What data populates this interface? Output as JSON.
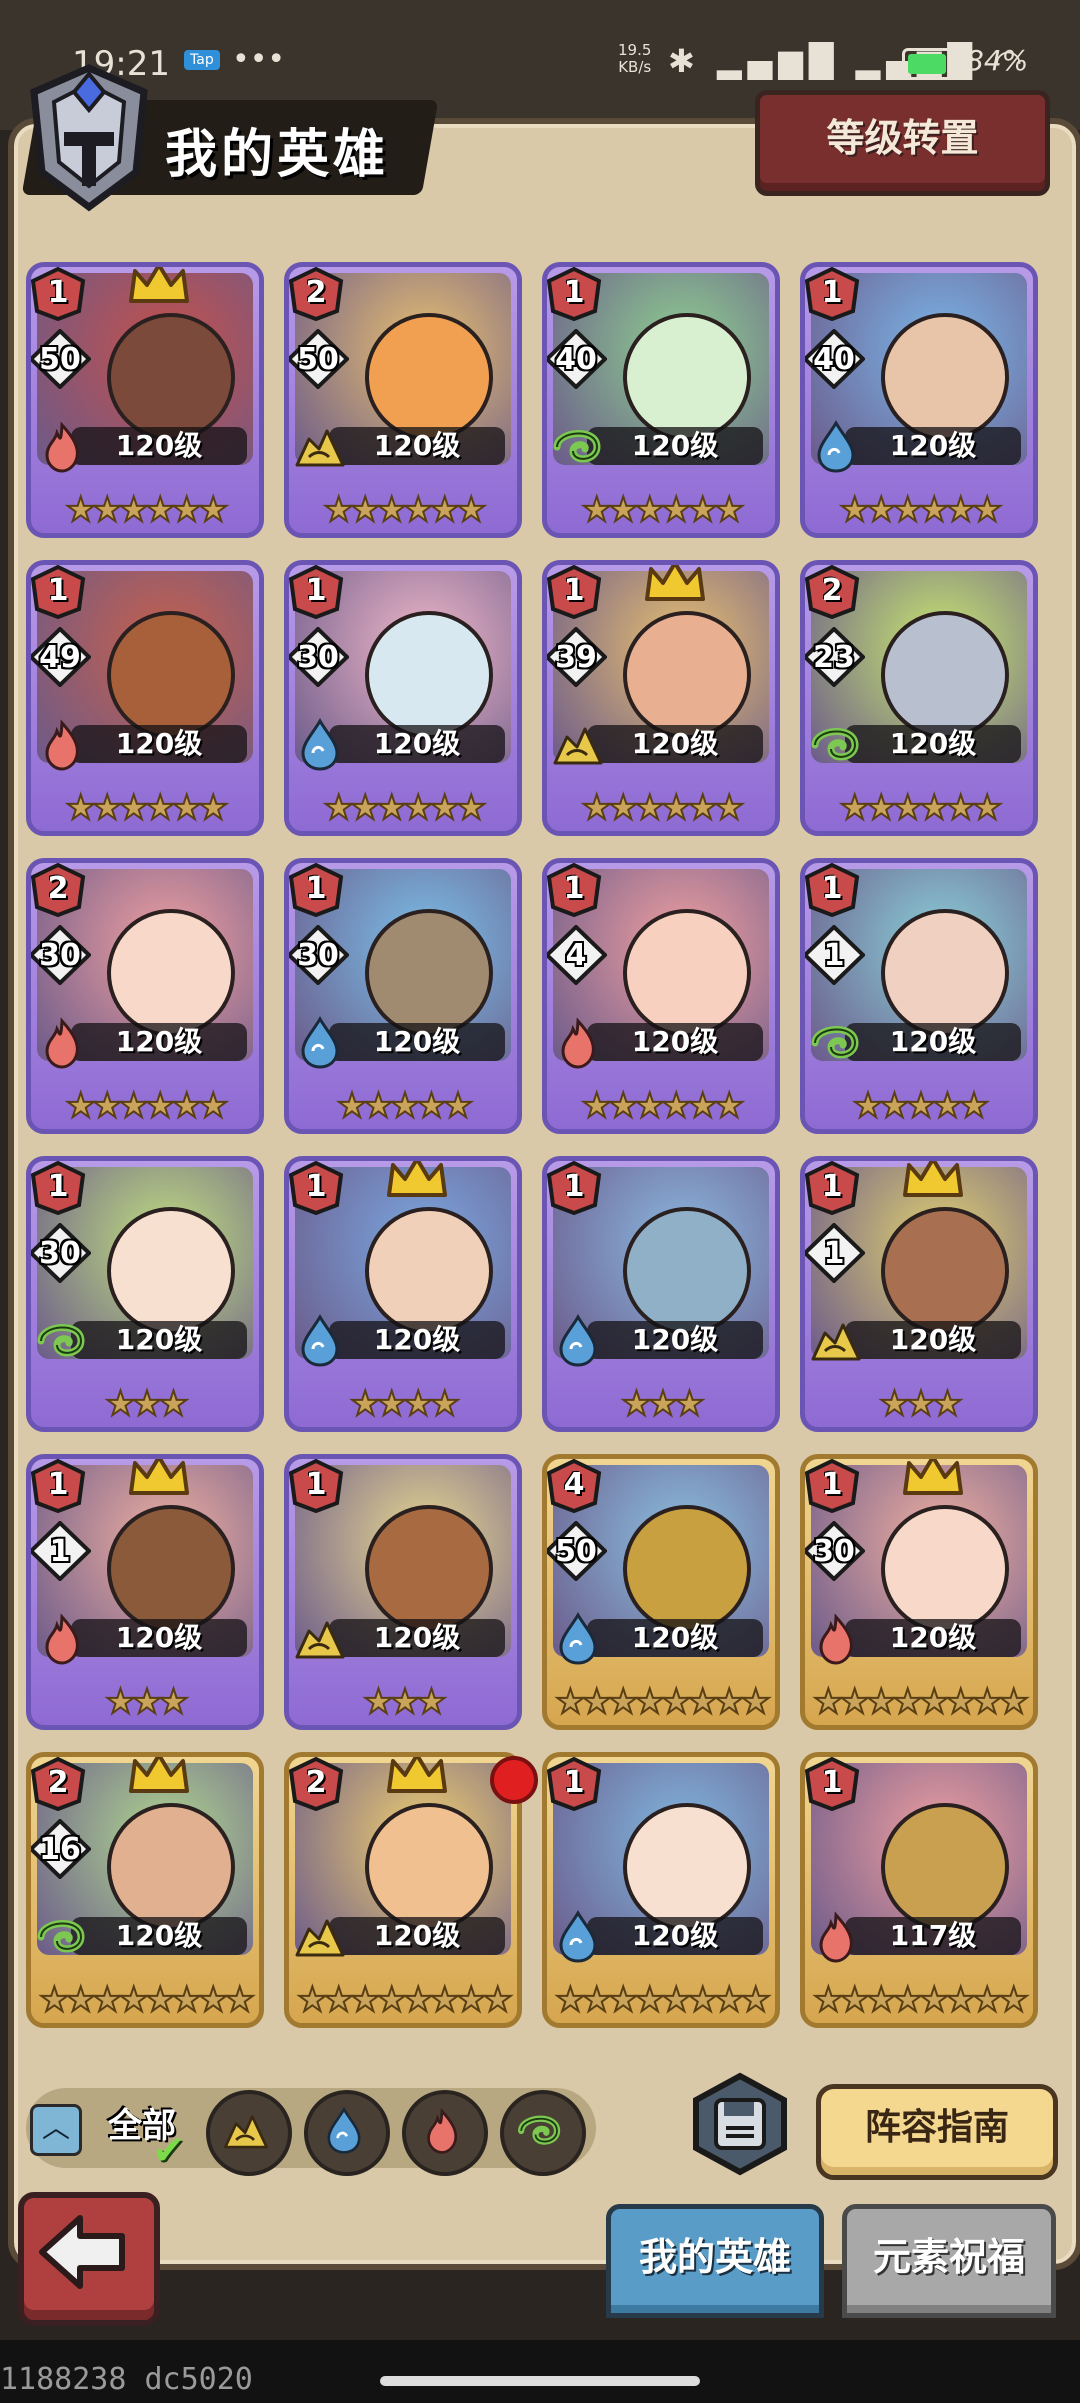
{
  "status_bar": {
    "time": "19:21",
    "app_badge": "Tap",
    "more": "•••",
    "net_speed_value": "19.5",
    "net_speed_unit": "KB/s",
    "net_icons": "✱ ▂▄▆█ ▂▄▆█ ◠",
    "battery": "84%",
    "battery_level": 0.84
  },
  "header": {
    "title": "我的英雄",
    "level_transfer_label": "等级转置"
  },
  "heroes": [
    {
      "rank": "1",
      "level_badge": "50",
      "level": "120级",
      "stars": "★★★★★★",
      "element": "fire",
      "crown": true,
      "frame": "purple",
      "bg": "#c4504a",
      "skin": "#7b4a3a"
    },
    {
      "rank": "2",
      "level_badge": "50",
      "level": "120级",
      "stars": "★★★★★★",
      "element": "earth",
      "crown": false,
      "frame": "purple",
      "bg": "#e8c070",
      "skin": "#f0a050"
    },
    {
      "rank": "1",
      "level_badge": "40",
      "level": "120级",
      "stars": "★★★★★★",
      "element": "wind",
      "crown": false,
      "frame": "purple",
      "bg": "#8ed090",
      "skin": "#d8f0d0"
    },
    {
      "rank": "1",
      "level_badge": "40",
      "level": "120级",
      "stars": "★★★★★★",
      "element": "water",
      "crown": false,
      "frame": "purple",
      "bg": "#7ab6e8",
      "skin": "#e8c4a8"
    },
    {
      "rank": "1",
      "level_badge": "49",
      "level": "120级",
      "stars": "★★★★★★",
      "element": "fire",
      "crown": false,
      "frame": "purple",
      "bg": "#c8604a",
      "skin": "#a8603a"
    },
    {
      "rank": "1",
      "level_badge": "30",
      "level": "120级",
      "stars": "★★★★★★",
      "element": "water",
      "crown": false,
      "frame": "purple",
      "bg": "#f0b8c8",
      "skin": "#d8e8f0"
    },
    {
      "rank": "1",
      "level_badge": "39",
      "level": "120级",
      "stars": "★★★★★★",
      "element": "earth",
      "crown": true,
      "frame": "purple",
      "bg": "#e8c070",
      "skin": "#e8b090"
    },
    {
      "rank": "2",
      "level_badge": "23",
      "level": "120级",
      "stars": "★★★★★★",
      "element": "wind",
      "crown": false,
      "frame": "purple",
      "bg": "#c8e870",
      "skin": "#b8c0d0"
    },
    {
      "rank": "2",
      "level_badge": "30",
      "level": "120级",
      "stars": "★★★★★★",
      "element": "fire",
      "crown": false,
      "frame": "purple",
      "bg": "#f0a0a0",
      "skin": "#f8d8c8"
    },
    {
      "rank": "1",
      "level_badge": "30",
      "level": "120级",
      "stars": "★★★★★",
      "element": "water",
      "crown": false,
      "frame": "purple",
      "bg": "#7ac0e8",
      "skin": "#a08a70"
    },
    {
      "rank": "1",
      "level_badge": "4",
      "level": "120级",
      "stars": "★★★★★★",
      "element": "fire",
      "crown": false,
      "frame": "purple",
      "bg": "#f0a0a0",
      "skin": "#f8d0c0"
    },
    {
      "rank": "1",
      "level_badge": "1",
      "level": "120级",
      "stars": "★★★★★",
      "element": "wind",
      "crown": false,
      "frame": "purple",
      "bg": "#8ad0d8",
      "skin": "#f0d0c0"
    },
    {
      "rank": "1",
      "level_badge": "30",
      "level": "120级",
      "stars": "★★★",
      "element": "wind",
      "crown": false,
      "frame": "purple",
      "bg": "#c0e080",
      "skin": "#f8e0d0"
    },
    {
      "rank": "1",
      "level_badge": "",
      "level": "120级",
      "stars": "★★★★",
      "element": "water",
      "crown": true,
      "frame": "purple",
      "bg": "#7aa8e0",
      "skin": "#f0d0b8"
    },
    {
      "rank": "1",
      "level_badge": "",
      "level": "120级",
      "stars": "★★★",
      "element": "water",
      "crown": false,
      "frame": "purple",
      "bg": "#8ab8e0",
      "skin": "#90b0c8"
    },
    {
      "rank": "1",
      "level_badge": "1",
      "level": "120级",
      "stars": "★★★",
      "element": "earth",
      "crown": true,
      "frame": "purple",
      "bg": "#e0d070",
      "skin": "#a87050"
    },
    {
      "rank": "1",
      "level_badge": "1",
      "level": "120级",
      "stars": "★★★",
      "element": "fire",
      "crown": true,
      "frame": "purple",
      "bg": "#f0b0a0",
      "skin": "#8a5a3a"
    },
    {
      "rank": "1",
      "level_badge": "",
      "level": "120级",
      "stars": "★★★",
      "element": "earth",
      "crown": false,
      "frame": "purple",
      "bg": "#e8d890",
      "skin": "#a86a40"
    },
    {
      "rank": "4",
      "level_badge": "50",
      "level": "120级",
      "stars": "★★★★★★★★",
      "element": "water",
      "crown": false,
      "frame": "gold",
      "bg": "#8ac0e0",
      "skin": "#c8a040"
    },
    {
      "rank": "1",
      "level_badge": "30",
      "level": "120级",
      "stars": "★★★★★★★★",
      "element": "fire",
      "crown": true,
      "frame": "gold",
      "bg": "#f0b0a0",
      "skin": "#f8d8c8"
    },
    {
      "rank": "2",
      "level_badge": "16",
      "level": "120级",
      "stars": "★★★★★★★★",
      "element": "wind",
      "crown": true,
      "frame": "gold",
      "bg": "#b0d890",
      "skin": "#e0b090"
    },
    {
      "rank": "2",
      "level_badge": "",
      "level": "120级",
      "stars": "★★★★★★★★",
      "element": "earth",
      "crown": true,
      "frame": "gold",
      "bg": "#f0d070",
      "skin": "#f0c090"
    },
    {
      "rank": "1",
      "level_badge": "",
      "level": "120级",
      "stars": "★★★★★★★★",
      "element": "water",
      "crown": false,
      "frame": "gold",
      "bg": "#80b8e0",
      "skin": "#f8e0d0"
    },
    {
      "rank": "1",
      "level_badge": "",
      "level": "117级",
      "stars": "★★★★★★★★",
      "element": "fire",
      "crown": false,
      "frame": "gold",
      "bg": "#f0a0a0",
      "skin": "#c8a050"
    }
  ],
  "filters": {
    "all_label": "全部",
    "chips": [
      "earth",
      "water",
      "fire",
      "wind"
    ]
  },
  "buttons": {
    "lineup_guide": "阵容指南",
    "save": "save-icon",
    "back": "back-arrow-icon"
  },
  "tabs": {
    "my_heroes": "我的英雄",
    "element_blessing": "元素祝福"
  },
  "footer": {
    "build_id": "1188238 dc5020"
  },
  "colors": {
    "fire": "#e8736a",
    "water": "#5aa0d8",
    "wind": "#7cc850",
    "earth": "#e8c84a",
    "purple_frame": "#8e6ad3",
    "gold_frame": "#d6a64e"
  }
}
